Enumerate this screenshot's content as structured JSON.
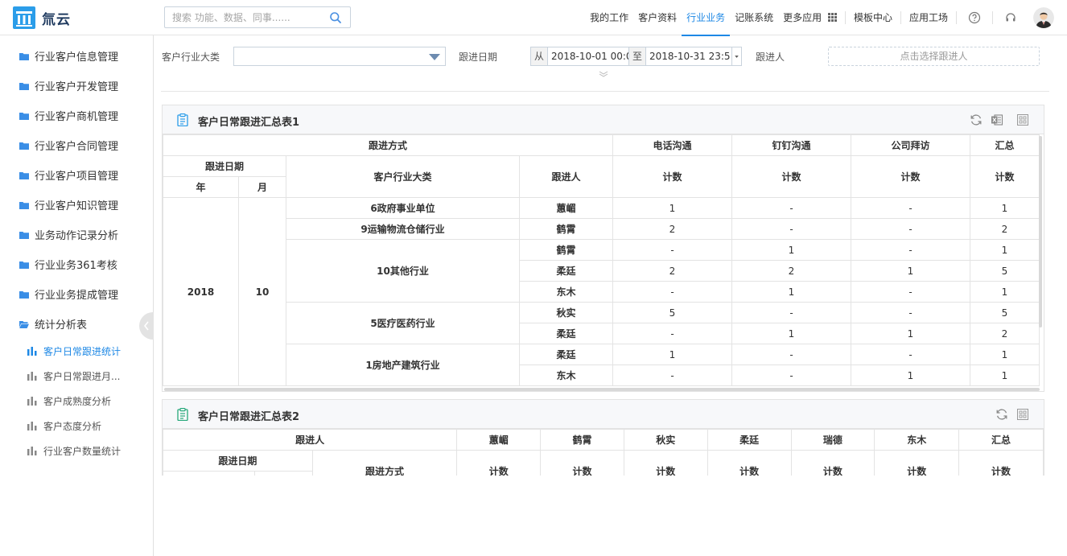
{
  "header": {
    "brand": "氚云",
    "search_placeholder": "搜索 功能、数据、同事......",
    "nav": [
      "我的工作",
      "客户资料",
      "行业业务",
      "记账系统",
      "更多应用",
      "模板中心",
      "应用工场"
    ],
    "active_nav": "行业业务",
    "accent_color": "#1e88e5"
  },
  "sidebar": {
    "items": [
      "行业客户信息管理",
      "行业客户开发管理",
      "行业客户商机管理",
      "行业客户合同管理",
      "行业客户项目管理",
      "行业客户知识管理",
      "业务动作记录分析",
      "行业业务361考核",
      "行业业务提成管理"
    ],
    "open_group": "统计分析表",
    "sub_items": [
      "客户日常跟进统计",
      "客户日常跟进月...",
      "客户成熟度分析",
      "客户态度分析",
      "行业客户数量统计"
    ],
    "active_sub": "客户日常跟进统计"
  },
  "filters": {
    "industry_label": "客户行业大类",
    "industry_value": "",
    "date_label": "跟进日期",
    "from_tag": "从",
    "from_value": "2018-10-01 00:0",
    "to_tag": "至",
    "to_value": "2018-10-31 23:5",
    "person_label": "跟进人",
    "person_button": "点击选择跟进人"
  },
  "table1": {
    "title": "客户日常跟进汇总表1",
    "h_method": "跟进方式",
    "methods": [
      "电话沟通",
      "钉钉沟通",
      "公司拜访",
      "汇总"
    ],
    "h_date": "跟进日期",
    "h_industry": "客户行业大类",
    "h_person": "跟进人",
    "h_count": "计数",
    "h_year": "年",
    "h_month": "月",
    "year": "2018",
    "month": "10",
    "groups": [
      {
        "industry": "6政府事业单位",
        "rows": [
          {
            "person": "蕙嵋",
            "v": [
              "1",
              "-",
              "-",
              "1"
            ]
          }
        ]
      },
      {
        "industry": "9运输物流仓储行业",
        "rows": [
          {
            "person": "鹤霄",
            "v": [
              "2",
              "-",
              "-",
              "2"
            ]
          }
        ]
      },
      {
        "industry": "10其他行业",
        "rows": [
          {
            "person": "鹤霄",
            "v": [
              "-",
              "1",
              "-",
              "1"
            ]
          },
          {
            "person": "柔廷",
            "v": [
              "2",
              "2",
              "1",
              "5"
            ]
          },
          {
            "person": "东木",
            "v": [
              "-",
              "1",
              "-",
              "1"
            ]
          }
        ]
      },
      {
        "industry": "5医疗医药行业",
        "rows": [
          {
            "person": "秋实",
            "v": [
              "5",
              "-",
              "-",
              "5"
            ]
          },
          {
            "person": "柔廷",
            "v": [
              "-",
              "1",
              "1",
              "2"
            ]
          }
        ]
      },
      {
        "industry": "1房地产建筑行业",
        "rows": [
          {
            "person": "柔廷",
            "v": [
              "1",
              "-",
              "-",
              "1"
            ]
          },
          {
            "person": "东木",
            "v": [
              "-",
              "-",
              "1",
              "1"
            ]
          }
        ]
      }
    ]
  },
  "table2": {
    "title": "客户日常跟进汇总表2",
    "h_person": "跟进人",
    "persons": [
      "蕙嵋",
      "鹤霄",
      "秋实",
      "柔廷",
      "瑞德",
      "东木",
      "汇总"
    ],
    "h_date": "跟进日期",
    "h_method": "跟进方式",
    "h_count": "计数"
  }
}
